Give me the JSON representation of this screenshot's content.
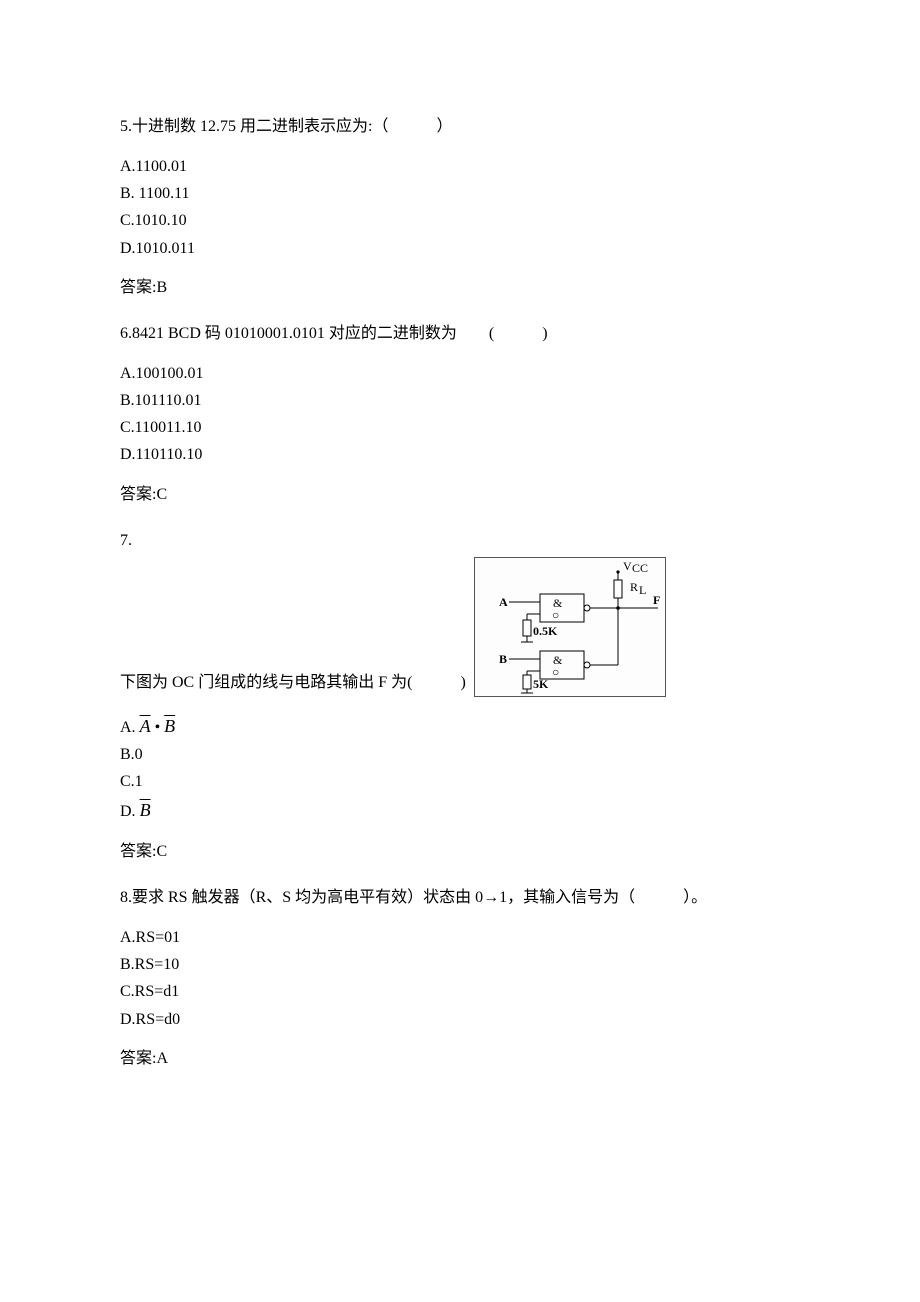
{
  "q5": {
    "stem": "5.十进制数 12.75 用二进制表示应为:（　　　）",
    "options": {
      "A": "A.1100.01",
      "B": "B. 1100.11",
      "C": "C.1010.10",
      "D": "D.1010.011"
    },
    "answer": "答案:B"
  },
  "q6": {
    "stem": "6.8421 BCD 码 01010001.0101 对应的二进制数为　　(　　　)",
    "options": {
      "A": "A.100100.01",
      "B": "B.101110.01",
      "C": "C.110011.10",
      "D": "D.110110.10"
    },
    "answer": "答案:C"
  },
  "q7": {
    "number": "7.",
    "stem": "下图为 OC 门组成的线与电路其输出 F 为(　　　)",
    "diagram": {
      "vcc": "V",
      "cc": "CC",
      "rl": "R",
      "l_sub": "L",
      "labelA": "A",
      "labelB": "B",
      "amp": "&",
      "circle": "○",
      "res1": "0.5K",
      "res2": "5K",
      "outF": "F"
    },
    "options": {
      "A_prefix": "A.",
      "A_bar1": "A",
      "A_dot": "•",
      "A_bar2": "B",
      "B": "B.0",
      "C": "C.1",
      "D_prefix": "D.",
      "D_bar": "B"
    },
    "answer": "答案:C"
  },
  "q8": {
    "stem": "8.要求 RS 触发器（R、S 均为高电平有效）状态由 0→1，其输入信号为（　　　）。",
    "options": {
      "A": "A.RS=01",
      "B": "B.RS=10",
      "C": "C.RS=d1",
      "D": "D.RS=d0"
    },
    "answer": "答案:A"
  }
}
